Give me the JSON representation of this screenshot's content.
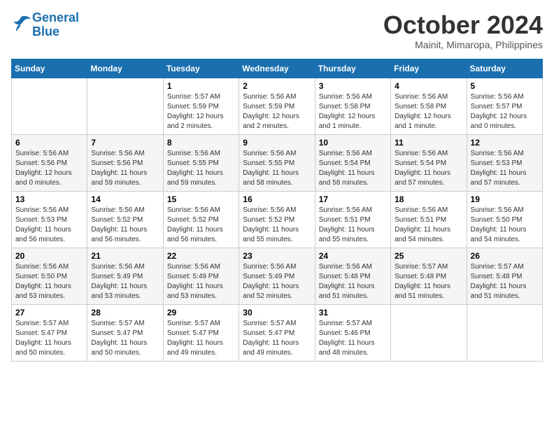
{
  "logo": {
    "line1": "General",
    "line2": "Blue"
  },
  "title": "October 2024",
  "location": "Mainit, Mimaropa, Philippines",
  "days_of_week": [
    "Sunday",
    "Monday",
    "Tuesday",
    "Wednesday",
    "Thursday",
    "Friday",
    "Saturday"
  ],
  "weeks": [
    [
      {
        "day": "",
        "detail": ""
      },
      {
        "day": "",
        "detail": ""
      },
      {
        "day": "1",
        "detail": "Sunrise: 5:57 AM\nSunset: 5:59 PM\nDaylight: 12 hours and 2 minutes."
      },
      {
        "day": "2",
        "detail": "Sunrise: 5:56 AM\nSunset: 5:59 PM\nDaylight: 12 hours and 2 minutes."
      },
      {
        "day": "3",
        "detail": "Sunrise: 5:56 AM\nSunset: 5:58 PM\nDaylight: 12 hours and 1 minute."
      },
      {
        "day": "4",
        "detail": "Sunrise: 5:56 AM\nSunset: 5:58 PM\nDaylight: 12 hours and 1 minute."
      },
      {
        "day": "5",
        "detail": "Sunrise: 5:56 AM\nSunset: 5:57 PM\nDaylight: 12 hours and 0 minutes."
      }
    ],
    [
      {
        "day": "6",
        "detail": "Sunrise: 5:56 AM\nSunset: 5:56 PM\nDaylight: 12 hours and 0 minutes."
      },
      {
        "day": "7",
        "detail": "Sunrise: 5:56 AM\nSunset: 5:56 PM\nDaylight: 11 hours and 59 minutes."
      },
      {
        "day": "8",
        "detail": "Sunrise: 5:56 AM\nSunset: 5:55 PM\nDaylight: 11 hours and 59 minutes."
      },
      {
        "day": "9",
        "detail": "Sunrise: 5:56 AM\nSunset: 5:55 PM\nDaylight: 11 hours and 58 minutes."
      },
      {
        "day": "10",
        "detail": "Sunrise: 5:56 AM\nSunset: 5:54 PM\nDaylight: 11 hours and 58 minutes."
      },
      {
        "day": "11",
        "detail": "Sunrise: 5:56 AM\nSunset: 5:54 PM\nDaylight: 11 hours and 57 minutes."
      },
      {
        "day": "12",
        "detail": "Sunrise: 5:56 AM\nSunset: 5:53 PM\nDaylight: 11 hours and 57 minutes."
      }
    ],
    [
      {
        "day": "13",
        "detail": "Sunrise: 5:56 AM\nSunset: 5:53 PM\nDaylight: 11 hours and 56 minutes."
      },
      {
        "day": "14",
        "detail": "Sunrise: 5:56 AM\nSunset: 5:52 PM\nDaylight: 11 hours and 56 minutes."
      },
      {
        "day": "15",
        "detail": "Sunrise: 5:56 AM\nSunset: 5:52 PM\nDaylight: 11 hours and 56 minutes."
      },
      {
        "day": "16",
        "detail": "Sunrise: 5:56 AM\nSunset: 5:52 PM\nDaylight: 11 hours and 55 minutes."
      },
      {
        "day": "17",
        "detail": "Sunrise: 5:56 AM\nSunset: 5:51 PM\nDaylight: 11 hours and 55 minutes."
      },
      {
        "day": "18",
        "detail": "Sunrise: 5:56 AM\nSunset: 5:51 PM\nDaylight: 11 hours and 54 minutes."
      },
      {
        "day": "19",
        "detail": "Sunrise: 5:56 AM\nSunset: 5:50 PM\nDaylight: 11 hours and 54 minutes."
      }
    ],
    [
      {
        "day": "20",
        "detail": "Sunrise: 5:56 AM\nSunset: 5:50 PM\nDaylight: 11 hours and 53 minutes."
      },
      {
        "day": "21",
        "detail": "Sunrise: 5:56 AM\nSunset: 5:49 PM\nDaylight: 11 hours and 53 minutes."
      },
      {
        "day": "22",
        "detail": "Sunrise: 5:56 AM\nSunset: 5:49 PM\nDaylight: 11 hours and 53 minutes."
      },
      {
        "day": "23",
        "detail": "Sunrise: 5:56 AM\nSunset: 5:49 PM\nDaylight: 11 hours and 52 minutes."
      },
      {
        "day": "24",
        "detail": "Sunrise: 5:56 AM\nSunset: 5:48 PM\nDaylight: 11 hours and 51 minutes."
      },
      {
        "day": "25",
        "detail": "Sunrise: 5:57 AM\nSunset: 5:48 PM\nDaylight: 11 hours and 51 minutes."
      },
      {
        "day": "26",
        "detail": "Sunrise: 5:57 AM\nSunset: 5:48 PM\nDaylight: 11 hours and 51 minutes."
      }
    ],
    [
      {
        "day": "27",
        "detail": "Sunrise: 5:57 AM\nSunset: 5:47 PM\nDaylight: 11 hours and 50 minutes."
      },
      {
        "day": "28",
        "detail": "Sunrise: 5:57 AM\nSunset: 5:47 PM\nDaylight: 11 hours and 50 minutes."
      },
      {
        "day": "29",
        "detail": "Sunrise: 5:57 AM\nSunset: 5:47 PM\nDaylight: 11 hours and 49 minutes."
      },
      {
        "day": "30",
        "detail": "Sunrise: 5:57 AM\nSunset: 5:47 PM\nDaylight: 11 hours and 49 minutes."
      },
      {
        "day": "31",
        "detail": "Sunrise: 5:57 AM\nSunset: 5:46 PM\nDaylight: 11 hours and 48 minutes."
      },
      {
        "day": "",
        "detail": ""
      },
      {
        "day": "",
        "detail": ""
      }
    ]
  ]
}
